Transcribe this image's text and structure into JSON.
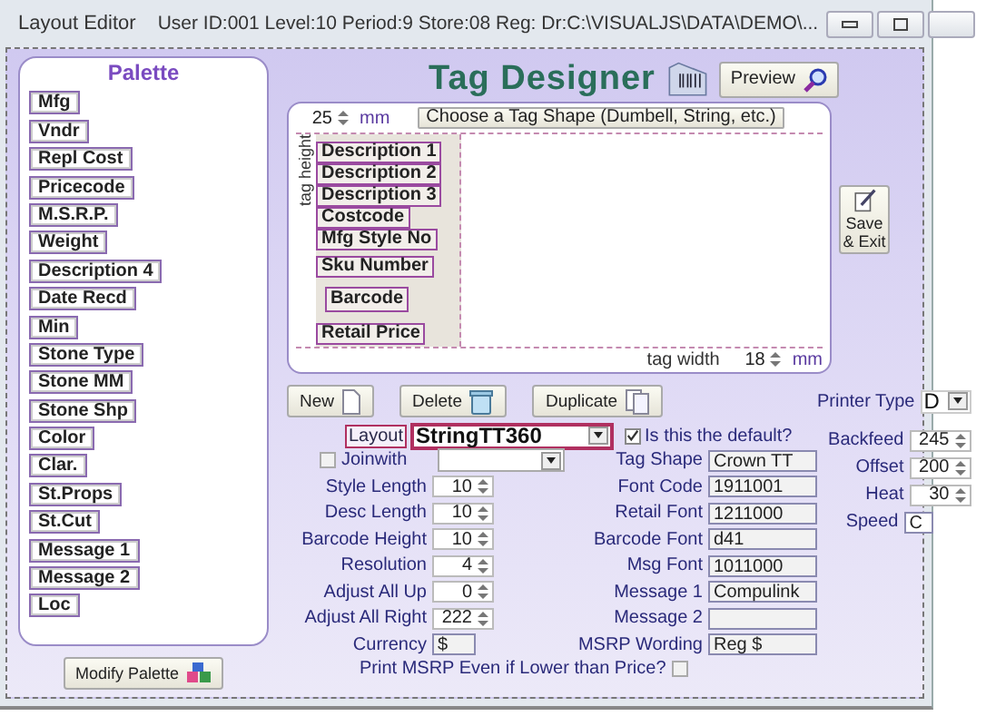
{
  "window": {
    "title": "Layout Editor",
    "info": "User ID:001 Level:10 Period:9 Store:08 Reg: Dr:C:\\VISUALJS\\DATA\\DEMO\\..."
  },
  "palette": {
    "title": "Palette",
    "items": [
      "Mfg",
      "Vndr",
      "Repl Cost",
      "Pricecode",
      "M.S.R.P.",
      "Weight",
      "Description 4",
      "Date Recd",
      "Min",
      "Stone Type",
      "Stone MM",
      "Stone Shp",
      "Color",
      "Clar.",
      "St.Props",
      "St.Cut",
      "Message 1",
      "Message 2",
      "Loc"
    ],
    "modify_button": "Modify Palette"
  },
  "designer": {
    "title": "Tag Designer",
    "preview_button": "Preview",
    "tag_height": {
      "label": "tag height",
      "value": "25",
      "unit": "mm"
    },
    "shape_button": "Choose a Tag Shape (Dumbell, String, etc.)",
    "tag_fields": [
      {
        "label": "Description 1",
        "kind": "text"
      },
      {
        "label": "Description 2",
        "kind": "text"
      },
      {
        "label": "Description 3",
        "kind": "text"
      },
      {
        "label": "Costcode",
        "kind": "text"
      },
      {
        "label": "Mfg Style No",
        "kind": "text"
      },
      {
        "label": "Sku Number",
        "kind": "text"
      },
      {
        "label": "Barcode",
        "kind": "barcode"
      },
      {
        "label": "Retail Price",
        "kind": "price"
      }
    ],
    "tag_width": {
      "label": "tag width",
      "value": "18",
      "unit": "mm"
    },
    "save_button": "Save & Exit"
  },
  "toolbar": {
    "buttons": [
      {
        "label": "New",
        "kind": "new"
      },
      {
        "label": "Delete",
        "kind": "delete"
      },
      {
        "label": "Duplicate",
        "kind": "duplicate"
      }
    ],
    "printer_type": {
      "label": "Printer Type",
      "value": "D"
    }
  },
  "layout": {
    "label": "Layout",
    "value": "StringTT360",
    "default": {
      "label": "Is this the default?",
      "checked": true
    }
  },
  "joinwith": {
    "label": "Joinwith",
    "checked": false
  },
  "settings": [
    {
      "label": "Style Length",
      "value": "10"
    },
    {
      "label": "Desc Length",
      "value": "10"
    },
    {
      "label": "Barcode Height",
      "value": "10"
    },
    {
      "label": "Resolution",
      "value": "4"
    },
    {
      "label": "Adjust All Up",
      "value": "0"
    },
    {
      "label": "Adjust All Right",
      "value": "222"
    }
  ],
  "currency": {
    "label": "Currency",
    "value": "$"
  },
  "fonts": [
    {
      "label": "Tag Shape",
      "value": "Crown TT"
    },
    {
      "label": "Font Code",
      "value": "1911001"
    },
    {
      "label": "Retail Font",
      "value": "1211000"
    },
    {
      "label": "Barcode Font",
      "value": "d41"
    },
    {
      "label": "Msg Font",
      "value": "1011000"
    },
    {
      "label": "Message 1",
      "value": "Compulink"
    },
    {
      "label": "Message 2"
    },
    {
      "label": "MSRP Wording",
      "value": "Reg $"
    }
  ],
  "print_msrp": {
    "label": "Print MSRP Even if Lower than Price?",
    "checked": false
  },
  "printer_settings": [
    {
      "label": "Backfeed",
      "value": "245",
      "kind": "spinner"
    },
    {
      "label": "Offset",
      "value": "200",
      "kind": "spinner"
    },
    {
      "label": "Heat",
      "value": "30",
      "kind": "spinner"
    },
    {
      "label": "Speed",
      "value": "C",
      "kind": "text"
    }
  ]
}
